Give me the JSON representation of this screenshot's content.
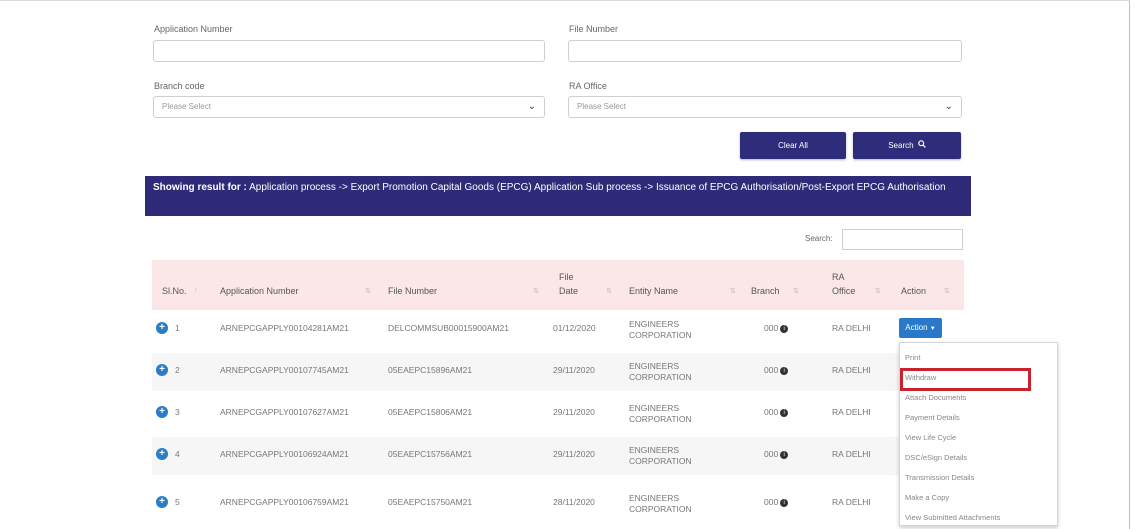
{
  "form": {
    "application_number_label": "Application Number",
    "file_number_label": "File Number",
    "branch_code_label": "Branch code",
    "ra_office_label": "RA Office",
    "branch_code_value": "Please Select",
    "ra_office_value": "Please Select",
    "clear_all_label": "Clear All",
    "search_label": "Search"
  },
  "banner": {
    "prefix": "Showing result for :",
    "text": "Application process -> Export Promotion Capital Goods (EPCG) Application Sub process -> Issuance of EPCG Authorisation/Post-Export EPCG Authorisation"
  },
  "table": {
    "search_label": "Search:",
    "headers": {
      "slno": "Sl.No.",
      "application_number": "Application Number",
      "file_number": "File Number",
      "file_date_1": "File",
      "file_date_2": "Date",
      "entity_name": "Entity Name",
      "branch": "Branch",
      "ra_office_1": "RA",
      "ra_office_2": "Office",
      "action": "Action"
    },
    "rows": [
      {
        "sl": "1",
        "app": "ARNEPCGAPPLY00104281AM21",
        "file": "DELCOMMSUB00015900AM21",
        "date": "01/12/2020",
        "entity1": "ENGINEERS",
        "entity2": "CORPORATION",
        "branch": "000",
        "ra": "RA DELHI"
      },
      {
        "sl": "2",
        "app": "ARNEPCGAPPLY00107745AM21",
        "file": "05EAEPC15896AM21",
        "date": "29/11/2020",
        "entity1": "ENGINEERS",
        "entity2": "CORPORATION",
        "branch": "000",
        "ra": "RA DELHI"
      },
      {
        "sl": "3",
        "app": "ARNEPCGAPPLY00107627AM21",
        "file": "05EAEPC15806AM21",
        "date": "29/11/2020",
        "entity1": "ENGINEERS",
        "entity2": "CORPORATION",
        "branch": "000",
        "ra": "RA DELHI"
      },
      {
        "sl": "4",
        "app": "ARNEPCGAPPLY00106924AM21",
        "file": "05EAEPC15756AM21",
        "date": "29/11/2020",
        "entity1": "ENGINEERS",
        "entity2": "CORPORATION",
        "branch": "000",
        "ra": "RA DELHI"
      },
      {
        "sl": "5",
        "app": "ARNEPCGAPPLY00106759AM21",
        "file": "05EAEPC15750AM21",
        "date": "28/11/2020",
        "entity1": "ENGINEERS",
        "entity2": "CORPORATION",
        "branch": "000",
        "ra": "RA DELHI"
      }
    ]
  },
  "action": {
    "button_label": "Action",
    "menu": [
      "Print",
      "Withdraw",
      "Attach Documents",
      "Payment Details",
      "View Life Cycle",
      "DSC/eSign Details",
      "Transmission Details",
      "Make a Copy",
      "View Submitted Attachments"
    ]
  },
  "colors": {
    "primary": "#2e2d7b",
    "header_bg": "#fbe7e8",
    "action_blue": "#2a79c8",
    "highlight": "#c8232c"
  }
}
